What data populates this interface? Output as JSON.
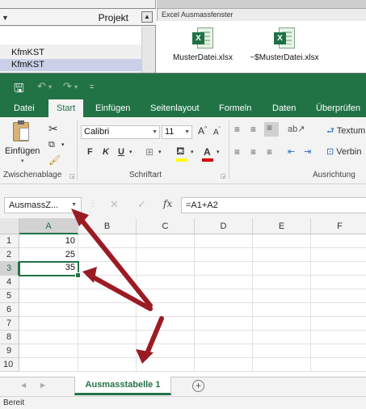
{
  "background_left": {
    "column_header": "Projekt",
    "rows": [
      "KfmKST",
      "KfmKST"
    ]
  },
  "background_right": {
    "window_title": "Excel Ausmassfenster",
    "files": [
      "MusterDatei.xlsx",
      "~$MusterDatei.xlsx"
    ]
  },
  "excel": {
    "tabs": [
      "Datei",
      "Start",
      "Einfügen",
      "Seitenlayout",
      "Formeln",
      "Daten",
      "Überprüfen"
    ],
    "active_tab": "Start",
    "clipboard": {
      "paste_label": "Einfügen",
      "group_label": "Zwischenablage"
    },
    "font": {
      "name": "Calibri",
      "size": "11",
      "bold": "F",
      "italic": "K",
      "underline": "U",
      "grow": "A",
      "shrink": "A",
      "color_letter": "A",
      "group_label": "Schriftart"
    },
    "alignment": {
      "wrap_label": "Textum",
      "merge_label": "Verbin",
      "group_label": "Ausrichtung"
    },
    "name_box": "AusmassZ...",
    "fx_label": "fx",
    "formula": "=A1+A2",
    "columns": [
      "A",
      "B",
      "C",
      "D",
      "E",
      "F"
    ],
    "rows": [
      "1",
      "2",
      "3",
      "4",
      "5",
      "6",
      "7",
      "8",
      "9",
      "10"
    ],
    "cells": {
      "A1": "10",
      "A2": "25",
      "A3": "35"
    },
    "active_cell": "A3",
    "sheet_tab": "Ausmasstabelle 1",
    "add_sheet": "+",
    "status": "Bereit"
  },
  "colors": {
    "excel_green": "#217346",
    "annotation_arrow": "#9b1b24",
    "selected_row_bg": "#c9d0e8"
  }
}
